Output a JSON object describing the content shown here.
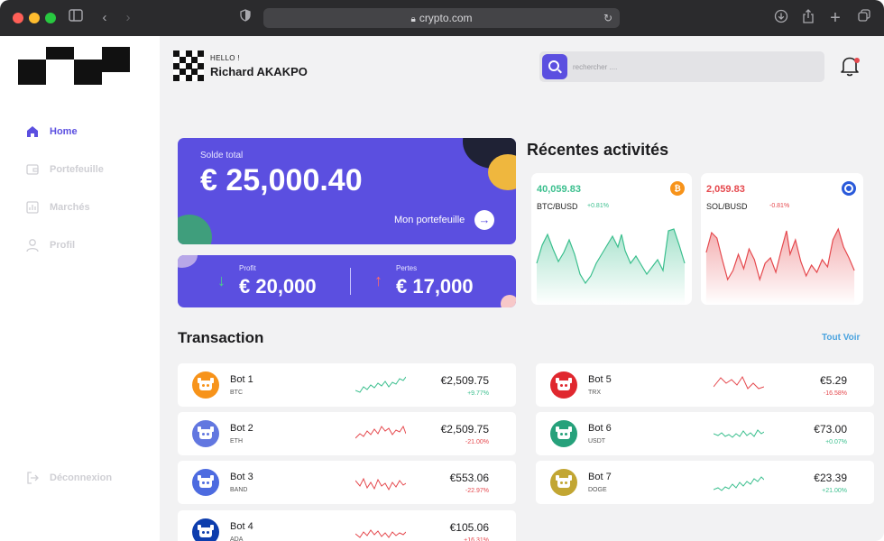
{
  "browser": {
    "url": "crypto.com"
  },
  "sidebar": {
    "items": [
      {
        "label": "Home",
        "icon": "home-icon",
        "active": true
      },
      {
        "label": "Portefeuille",
        "icon": "wallet-icon",
        "active": false
      },
      {
        "label": "Marchés",
        "icon": "chart-icon",
        "active": false
      },
      {
        "label": "Profil",
        "icon": "user-icon",
        "active": false
      }
    ],
    "logout": "Déconnexion"
  },
  "header": {
    "greeting": "HELLO !",
    "user_name": "Richard AKAKPO",
    "search_placeholder": "rechercher ...."
  },
  "balance": {
    "label": "Solde total",
    "value": "€ 25,000.40",
    "link": "Mon portefeuille"
  },
  "profit_loss": {
    "profit_label": "Profit",
    "profit_value": "€ 20,000",
    "loss_label": "Pertes",
    "loss_value": "€ 17,000"
  },
  "activities": {
    "title": "Récentes activités",
    "cards": [
      {
        "price": "40,059.83",
        "pair": "BTC/BUSD",
        "change": "+0.81%",
        "coin": "bitcoin-icon",
        "color": "#3bbf8e",
        "coin_color": "#f7931a"
      },
      {
        "price": "2,059.83",
        "pair": "SOL/BUSD",
        "change": "-0.81%",
        "coin": "solana-icon",
        "color": "#e5484d",
        "coin_color": "#2a5ada"
      }
    ]
  },
  "transactions": {
    "title": "Transaction",
    "view_all": "Tout Voir",
    "rows": [
      {
        "name": "Bot 1",
        "symbol": "BTC",
        "amount": "€2,509.75",
        "change": "+9.77%",
        "positive": true,
        "icon_color": "#f7931a"
      },
      {
        "name": "Bot 2",
        "symbol": "ETH",
        "amount": "€2,509.75",
        "change": "-21.00%",
        "positive": false,
        "icon_color": "#6277e0"
      },
      {
        "name": "Bot 3",
        "symbol": "BAND",
        "amount": "€553.06",
        "change": "-22.97%",
        "positive": false,
        "icon_color": "#4d6be0"
      },
      {
        "name": "Bot 4",
        "symbol": "ADA",
        "amount": "€105.06",
        "change": "+16.31%",
        "positive": false,
        "icon_color": "#0d3dad"
      },
      {
        "name": "Bot 5",
        "symbol": "TRX",
        "amount": "€5.29",
        "change": "-16.58%",
        "positive": false,
        "icon_color": "#e0282f"
      },
      {
        "name": "Bot 6",
        "symbol": "USDT",
        "amount": "€73.00",
        "change": "+0.07%",
        "positive": true,
        "icon_color": "#26a17b"
      },
      {
        "name": "Bot 7",
        "symbol": "DOGE",
        "amount": "€23.39",
        "change": "+21.00%",
        "positive": true,
        "icon_color": "#c2a633"
      }
    ]
  }
}
